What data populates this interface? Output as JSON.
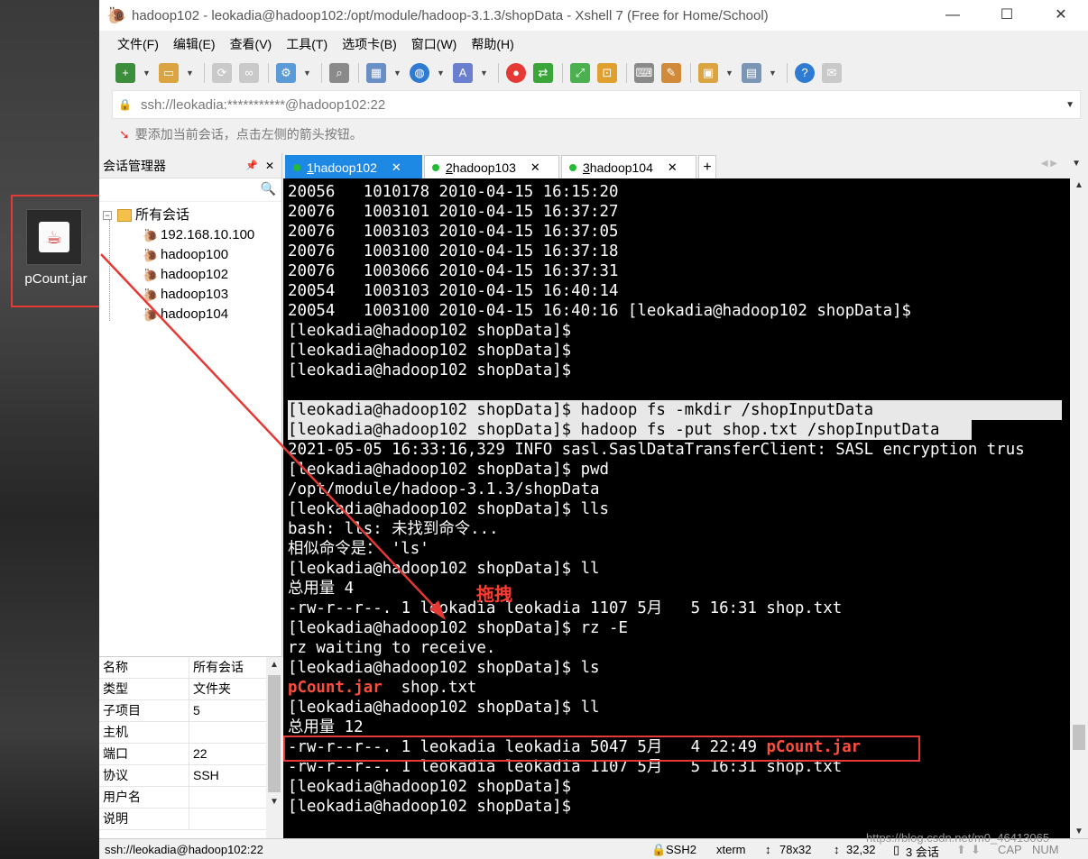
{
  "window": {
    "title": "hadoop102 - leokadia@hadoop102:/opt/module/hadoop-3.1.3/shopData - Xshell 7 (Free for Home/School)",
    "minimize": "—",
    "maximize": "☐",
    "close": "✕"
  },
  "desktop": {
    "icon_label": "pCount.jar"
  },
  "menu": [
    "文件(F)",
    "编辑(E)",
    "查看(V)",
    "工具(T)",
    "选项卡(B)",
    "窗口(W)",
    "帮助(H)"
  ],
  "address": {
    "value": "ssh://leokadia:***********@hadoop102:22"
  },
  "hint": "要添加当前会话，点击左侧的箭头按钮。",
  "session_manager": {
    "title": "会话管理器",
    "root": "所有会话",
    "items": [
      "192.168.10.100",
      "hadoop100",
      "hadoop102",
      "hadoop103",
      "hadoop104"
    ]
  },
  "properties": [
    {
      "k": "名称",
      "v": "所有会话"
    },
    {
      "k": "类型",
      "v": "文件夹"
    },
    {
      "k": "子项目",
      "v": "5"
    },
    {
      "k": "主机",
      "v": ""
    },
    {
      "k": "端口",
      "v": "22"
    },
    {
      "k": "协议",
      "v": "SSH"
    },
    {
      "k": "用户名",
      "v": ""
    },
    {
      "k": "说明",
      "v": ""
    }
  ],
  "tabs": [
    {
      "num": "1",
      "label": " hadoop102"
    },
    {
      "num": "2",
      "label": " hadoop103"
    },
    {
      "num": "3",
      "label": " hadoop104"
    }
  ],
  "terminal": [
    "20056   1010178 2010-04-15 16:15:20",
    "20076   1003101 2010-04-15 16:37:27",
    "20076   1003103 2010-04-15 16:37:05",
    "20076   1003100 2010-04-15 16:37:18",
    "20076   1003066 2010-04-15 16:37:31",
    "20054   1003103 2010-04-15 16:40:14",
    "20054   1003100 2010-04-15 16:40:16 [leokadia@hadoop102 shopData]$",
    "[leokadia@hadoop102 shopData]$",
    "[leokadia@hadoop102 shopData]$",
    "[leokadia@hadoop102 shopData]$",
    "[leokadia@hadoop102 shopData]$ hadoop fs -mkdir /shopInputData",
    "[leokadia@hadoop102 shopData]$ hadoop fs -put shop.txt /shopInputData",
    "2021-05-05 16:33:16,329 INFO sasl.SaslDataTransferClient: SASL encryption trus",
    "[leokadia@hadoop102 shopData]$ pwd",
    "/opt/module/hadoop-3.1.3/shopData",
    "[leokadia@hadoop102 shopData]$ lls",
    "bash: lls: 未找到命令...",
    "相似命令是： 'ls'",
    "[leokadia@hadoop102 shopData]$ ll",
    "总用量 4",
    "-rw-r--r--. 1 leokadia leokadia 1107 5月   5 16:31 shop.txt",
    "[leokadia@hadoop102 shopData]$ rz -E",
    "rz waiting to receive.",
    "[leokadia@hadoop102 shopData]$ ls",
    "[leokadia@hadoop102 shopData]$ ll",
    "总用量 12",
    "-rw-r--r--. 1 leokadia leokadia 1107 5月   5 16:31 shop.txt",
    "[leokadia@hadoop102 shopData]$",
    "[leokadia@hadoop102 shopData]$"
  ],
  "terminal_special": {
    "ls_jar": "pCount.jar",
    "ls_txt": "  shop.txt",
    "ll_jar_prefix": "-rw-r--r--. 1 leokadia leokadia 5047 5月   4 22:49 ",
    "ll_jar_name": "pCount.jar"
  },
  "annotation": {
    "drag_label": "拖拽"
  },
  "watermark": "https://blog.csdn.net/m0_46413065",
  "status": {
    "session": "ssh://leokadia@hadoop102:22",
    "protocol": "SSH2",
    "term": "xterm",
    "size": "78x32",
    "cursor": "32,32",
    "sessions": "3 会话",
    "caps": "CAP",
    "num": "NUM"
  },
  "colors": {
    "accent": "#1e88e5",
    "annotation_red": "#e53935",
    "highlight_red": "#ff4d3d"
  }
}
